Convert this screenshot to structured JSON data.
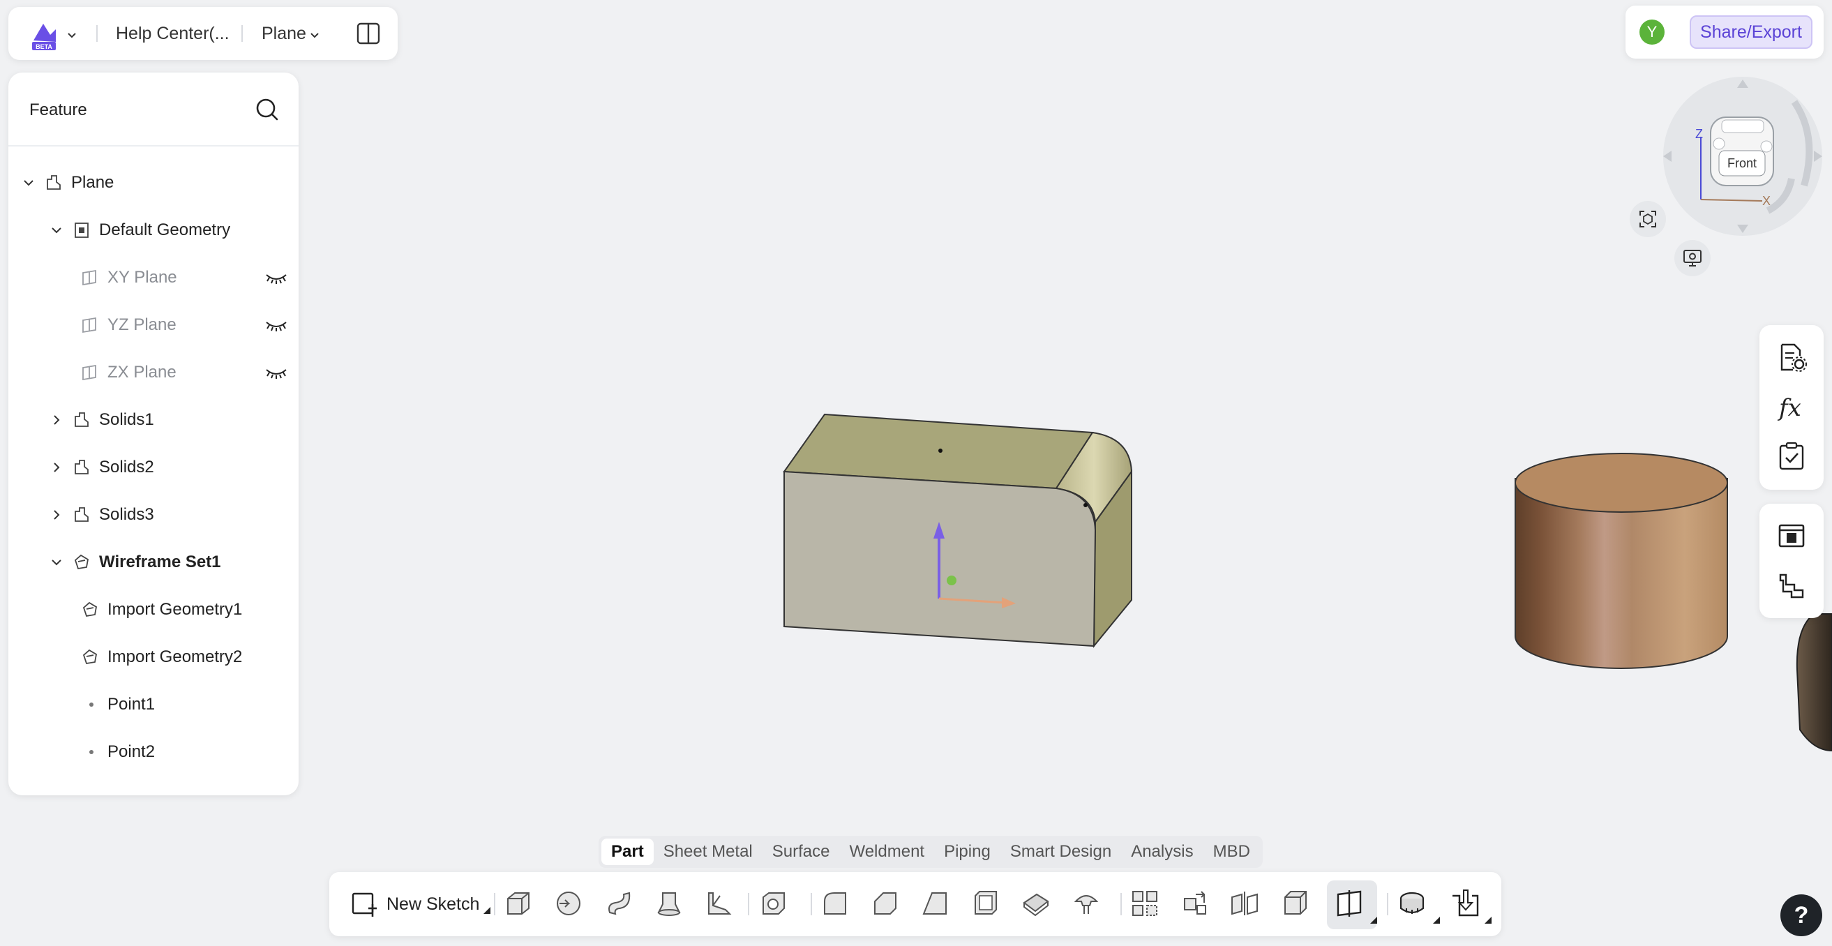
{
  "topbar": {
    "breadcrumb_doc": "Help Center(...",
    "breadcrumb_part": "Plane",
    "logo_badge": "BETA"
  },
  "feature_panel": {
    "title": "Feature",
    "tree": [
      {
        "label": "Plane",
        "level": 0,
        "expanded": true,
        "icon": "part-icon"
      },
      {
        "label": "Default Geometry",
        "level": 1,
        "expanded": true,
        "icon": "geometry-icon"
      },
      {
        "label": "XY Plane",
        "level": 2,
        "dim": true,
        "icon": "plane-icon",
        "hidden": true
      },
      {
        "label": "YZ Plane",
        "level": 2,
        "dim": true,
        "icon": "plane-icon",
        "hidden": true
      },
      {
        "label": "ZX Plane",
        "level": 2,
        "dim": true,
        "icon": "plane-icon",
        "hidden": true
      },
      {
        "label": "Solids1",
        "level": 1,
        "expanded": false,
        "icon": "solid-icon"
      },
      {
        "label": "Solids2",
        "level": 1,
        "expanded": false,
        "icon": "solid-icon"
      },
      {
        "label": "Solids3",
        "level": 1,
        "expanded": false,
        "icon": "solid-icon"
      },
      {
        "label": "Wireframe Set1",
        "level": 1,
        "expanded": true,
        "bold": true,
        "icon": "wireframe-icon"
      },
      {
        "label": "Import Geometry1",
        "level": 2,
        "icon": "import-icon"
      },
      {
        "label": "Import Geometry2",
        "level": 2,
        "icon": "import-icon"
      },
      {
        "label": "Point1",
        "level": 2,
        "icon": "point-icon"
      },
      {
        "label": "Point2",
        "level": 2,
        "icon": "point-icon"
      }
    ]
  },
  "header_right": {
    "avatar_letter": "Y",
    "share_label": "Share/Export"
  },
  "viewcube": {
    "face_label": "Front",
    "axis_z": "Z",
    "axis_x": "X"
  },
  "tabs": [
    "Part",
    "Sheet Metal",
    "Surface",
    "Weldment",
    "Piping",
    "Smart Design",
    "Analysis",
    "MBD"
  ],
  "active_tab": "Part",
  "toolbar": {
    "new_sketch_label": "New Sketch"
  },
  "help_label": "?",
  "colors": {
    "accent": "#5b43d6",
    "box_top": "#a8a67a",
    "box_front": "#b9b6a8",
    "box_side": "#9e9b6e",
    "cylinder": "#b68a62"
  }
}
